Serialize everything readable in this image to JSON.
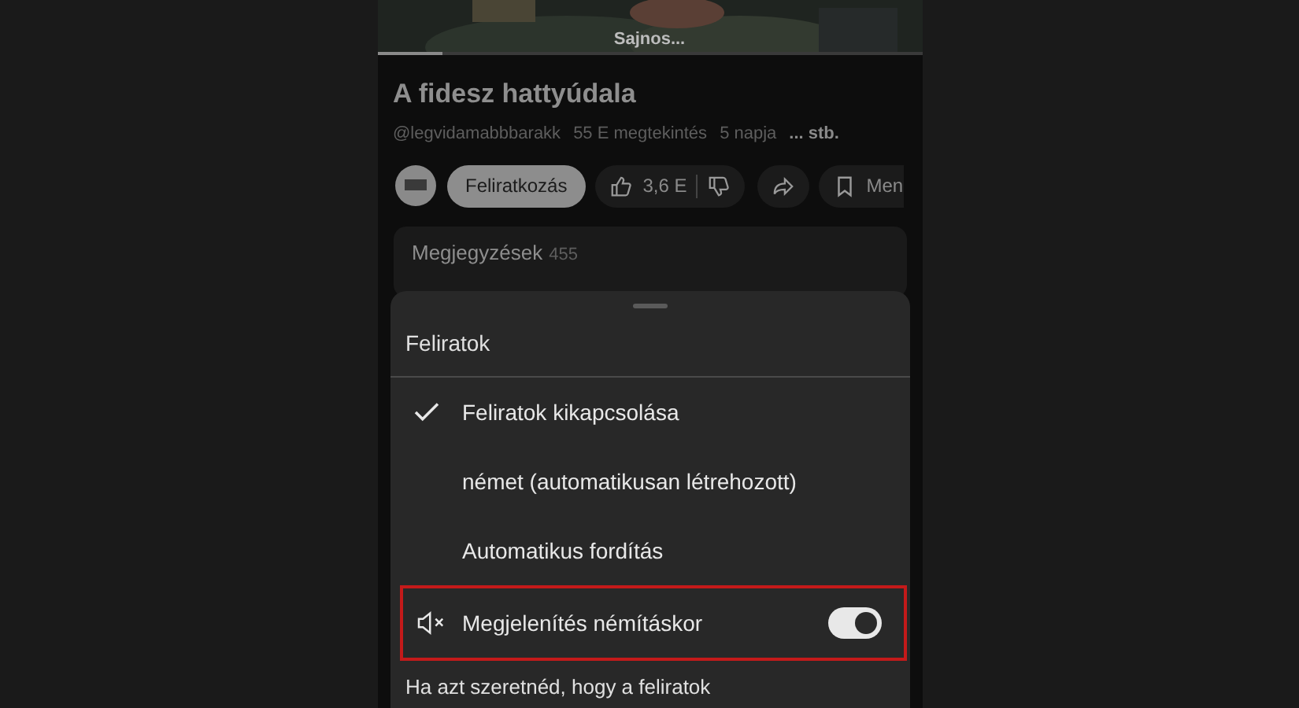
{
  "video": {
    "subtitle": "Sajnos...",
    "level": 0.12
  },
  "title": "A fidesz hattyúdala",
  "meta": {
    "channel": "@legvidamabbbarakk",
    "views": "55 E megtekintés",
    "age": "5 napja",
    "more": "... stb."
  },
  "actions": {
    "subscribe": "Feliratkozás",
    "likes": "3,6 E",
    "save": "Men"
  },
  "comments": {
    "label": "Megjegyzések",
    "count": "455"
  },
  "sheet": {
    "title": "Feliratok",
    "options": [
      {
        "label": "Feliratok kikapcsolása",
        "selected": true
      },
      {
        "label": "német (automatikusan létrehozott)",
        "selected": false
      },
      {
        "label": "Automatikus fordítás",
        "selected": false
      }
    ],
    "mute_row": {
      "label": "Megjelenítés némításkor",
      "on": true,
      "highlighted": true
    },
    "description": "Ha azt szeretnéd, hogy a feliratok"
  }
}
